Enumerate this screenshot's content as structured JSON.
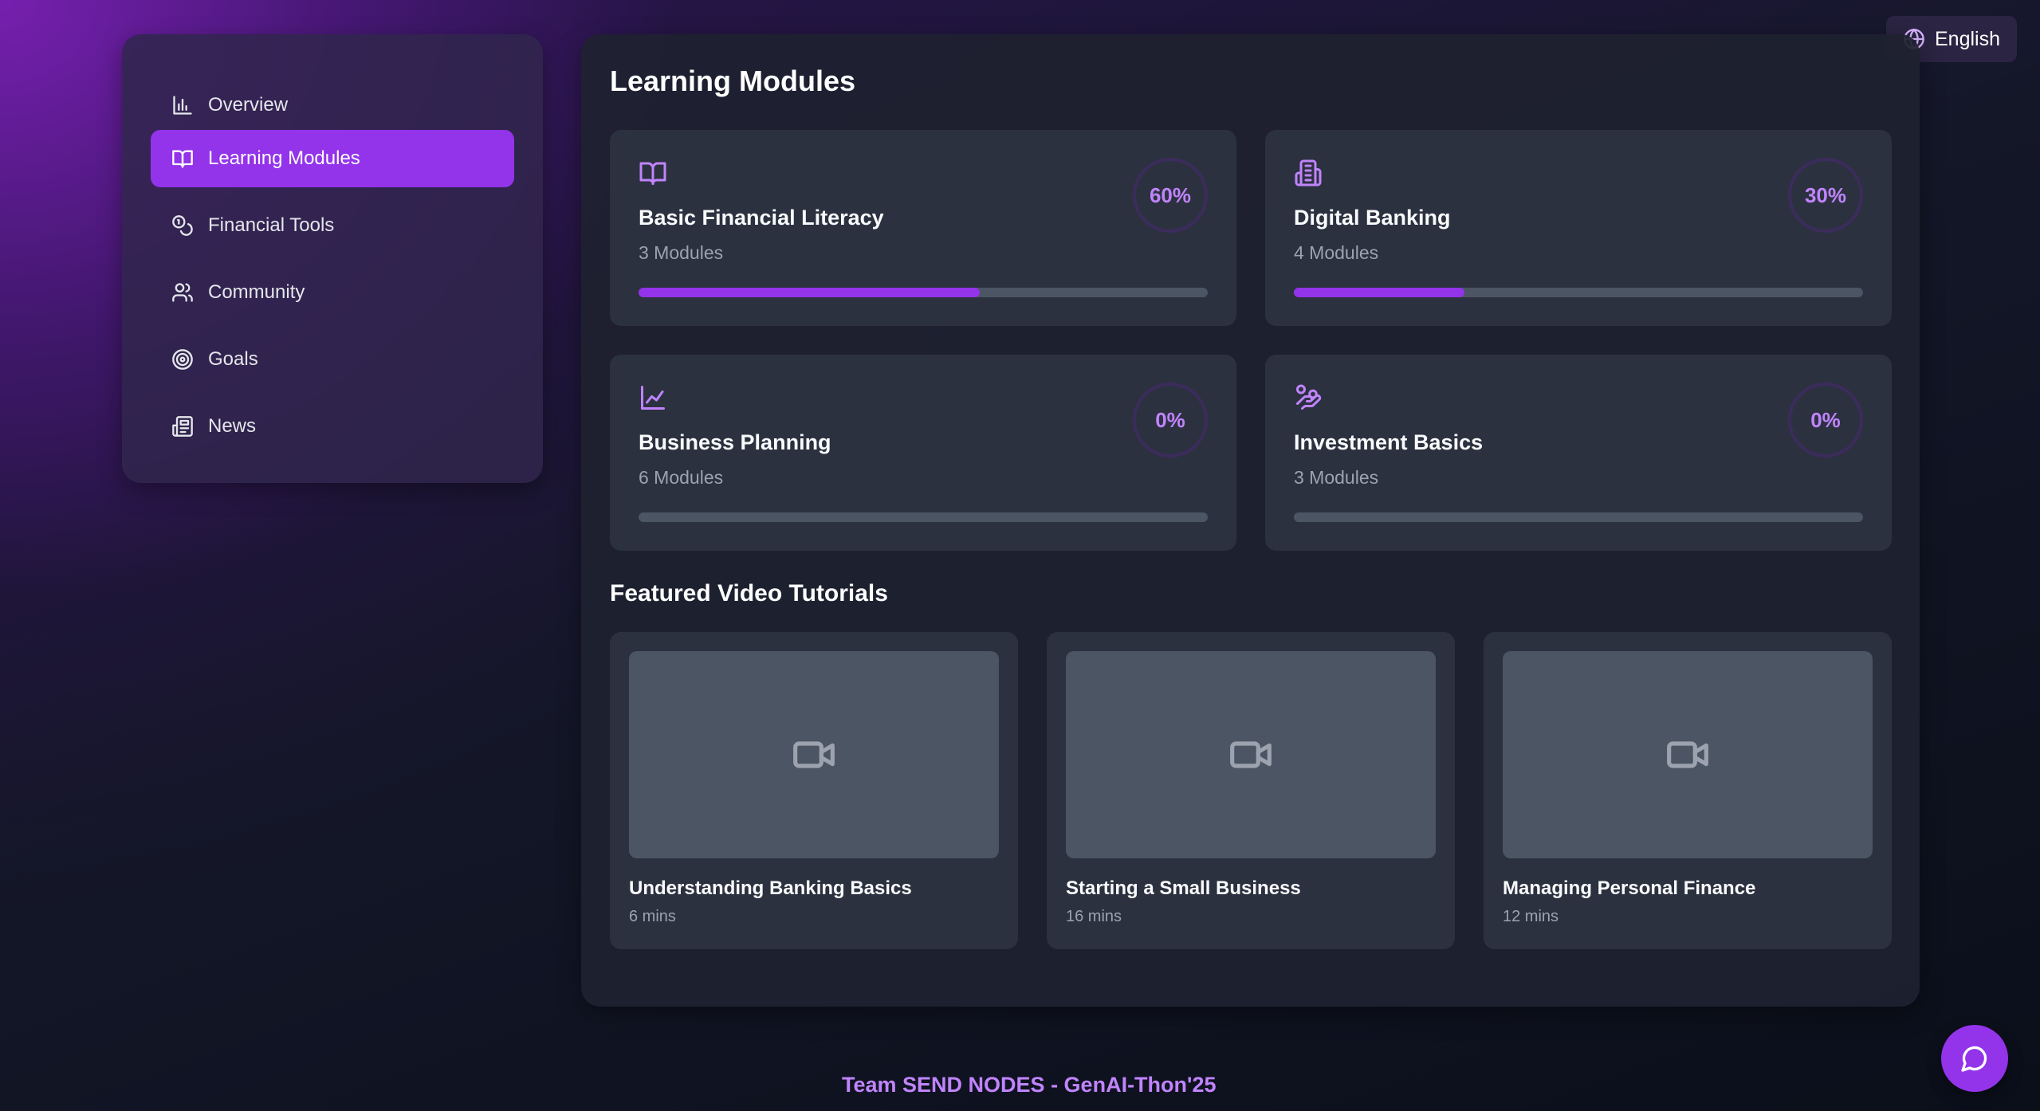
{
  "language": {
    "label": "English",
    "icon": "globe-icon"
  },
  "sidebar": {
    "items": [
      {
        "label": "Overview",
        "icon": "bar-chart-icon",
        "active": false
      },
      {
        "label": "Learning Modules",
        "icon": "book-open-icon",
        "active": true
      },
      {
        "label": "Financial Tools",
        "icon": "coins-icon",
        "active": false
      },
      {
        "label": "Community",
        "icon": "users-icon",
        "active": false
      },
      {
        "label": "Goals",
        "icon": "target-icon",
        "active": false
      },
      {
        "label": "News",
        "icon": "newspaper-icon",
        "active": false
      }
    ]
  },
  "main": {
    "title": "Learning Modules",
    "modules": [
      {
        "title": "Basic Financial Literacy",
        "subtitle": "3 Modules",
        "progress_label": "60%",
        "progress": 0.6,
        "icon": "book-open-icon"
      },
      {
        "title": "Digital Banking",
        "subtitle": "4 Modules",
        "progress_label": "30%",
        "progress": 0.3,
        "icon": "building-icon"
      },
      {
        "title": "Business Planning",
        "subtitle": "6 Modules",
        "progress_label": "0%",
        "progress": 0,
        "icon": "line-chart-icon"
      },
      {
        "title": "Investment Basics",
        "subtitle": "3 Modules",
        "progress_label": "0%",
        "progress": 0,
        "icon": "hand-coins-icon"
      }
    ],
    "videos_title": "Featured Video Tutorials",
    "videos": [
      {
        "title": "Understanding Banking Basics",
        "duration": "6 mins",
        "icon": "video-icon"
      },
      {
        "title": "Starting a Small Business",
        "duration": "16 mins",
        "icon": "video-icon"
      },
      {
        "title": "Managing Personal Finance",
        "duration": "12 mins",
        "icon": "video-icon"
      }
    ]
  },
  "footer": {
    "text": "Team SEND NODES - GenAI-Thon'25"
  },
  "chat": {
    "icon": "chat-bubble-icon"
  },
  "colors": {
    "accent": "#9333ea",
    "accent_light": "#c084fc",
    "card": "#2c3140",
    "track": "#4b5563"
  }
}
